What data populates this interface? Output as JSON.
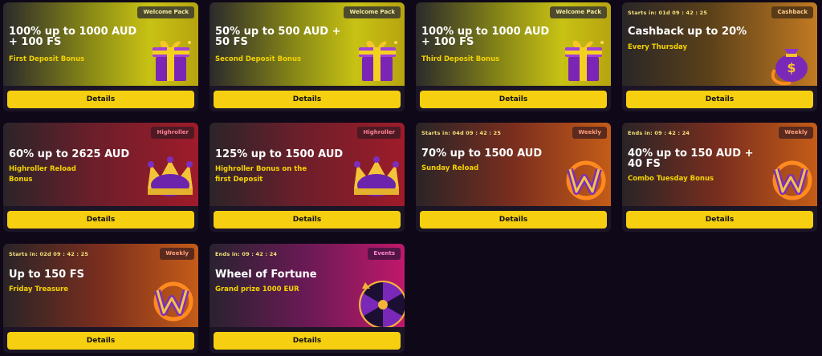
{
  "cards": [
    {
      "badge": "Welcome Pack",
      "timer": "",
      "title": "100% up to 1000 AUD + 100 FS",
      "subtitle": "First Deposit Bonus",
      "button": "Details",
      "icon": "gift-box-icon"
    },
    {
      "badge": "Welcome Pack",
      "timer": "",
      "title": "50% up to 500 AUD + 50 FS",
      "subtitle": "Second Deposit Bonus",
      "button": "Details",
      "icon": "gift-box-icon"
    },
    {
      "badge": "Welcome Pack",
      "timer": "",
      "title": "100% up to 1000 AUD + 100 FS",
      "subtitle": "Third Deposit Bonus",
      "button": "Details",
      "icon": "gift-box-icon"
    },
    {
      "badge": "Cashback",
      "timer": "Starts in: 01d 09 : 42 : 25",
      "title": "Cashback up to 20%",
      "subtitle": "Every Thursday",
      "button": "Details",
      "icon": "money-bag-icon"
    },
    {
      "badge": "Highroller",
      "timer": "",
      "title": "60% up to 2625 AUD",
      "subtitle": "Highroller Reload Bonus",
      "button": "Details",
      "icon": "crown-icon"
    },
    {
      "badge": "Highroller",
      "timer": "",
      "title": "125% up to 1500 AUD",
      "subtitle": "Highroller Bonus on the first Deposit",
      "button": "Details",
      "icon": "crown-icon"
    },
    {
      "badge": "Weekly",
      "timer": "Starts in: 04d 09 : 42 : 25",
      "title": "70% up to 1500 AUD",
      "subtitle": "Sunday Reload",
      "button": "Details",
      "icon": "w-logo-icon"
    },
    {
      "badge": "Weekly",
      "timer": "Ends in: 09 : 42 : 24",
      "title": "40% up to 150 AUD + 40 FS",
      "subtitle": "Combo Tuesday Bonus",
      "button": "Details",
      "icon": "w-logo-icon"
    },
    {
      "badge": "Weekly",
      "timer": "Starts in: 02d 09 : 42 : 25",
      "title": "Up to 150 FS",
      "subtitle": "Friday Treasure",
      "button": "Details",
      "icon": "w-logo-icon"
    },
    {
      "badge": "Events",
      "timer": "Ends in: 09 : 42 : 24",
      "title": "Wheel of Fortune",
      "subtitle": "Grand prize 1000 EUR",
      "button": "Details",
      "icon": "fortune-wheel-icon"
    }
  ],
  "colors": {
    "button": "#f5cf10",
    "title": "#ffffff",
    "subtitle": "#f5d300",
    "background": "#0e0818"
  }
}
